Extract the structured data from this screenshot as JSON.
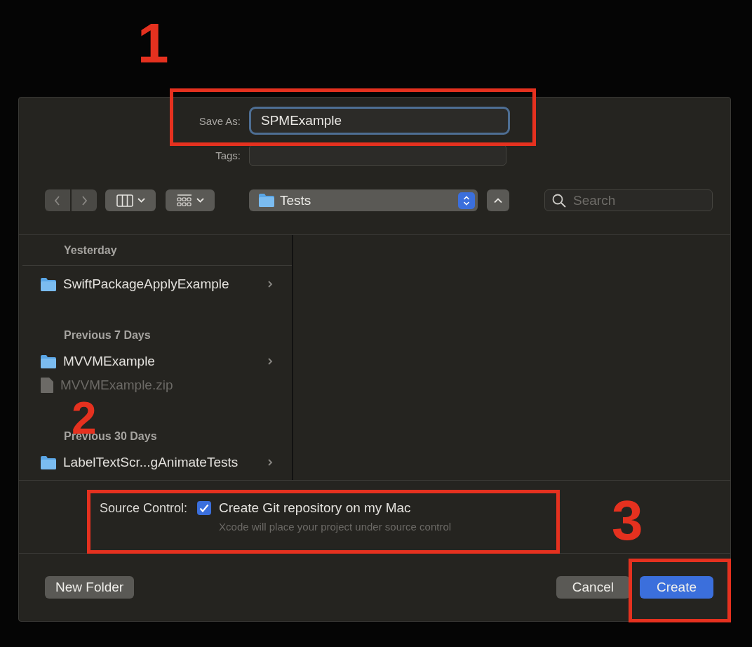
{
  "callouts": [
    {
      "label": "1"
    },
    {
      "label": "2"
    },
    {
      "label": "3"
    }
  ],
  "save_as": {
    "label": "Save As:",
    "value": "SPMExample"
  },
  "tags": {
    "label": "Tags:"
  },
  "toolbar": {
    "location": "Tests",
    "search_placeholder": "Search"
  },
  "sidebar": {
    "groups": [
      {
        "title": "Yesterday",
        "items": [
          {
            "name": "SwiftPackageApplyExample",
            "kind": "folder",
            "disabled": false
          }
        ]
      },
      {
        "title": "Previous 7 Days",
        "items": [
          {
            "name": "MVVMExample",
            "kind": "folder",
            "disabled": false
          },
          {
            "name": "MVVMExample.zip",
            "kind": "file",
            "disabled": true
          }
        ]
      },
      {
        "title": "Previous 30 Days",
        "items": [
          {
            "name": "LabelTextScr...gAnimateTests",
            "kind": "folder",
            "disabled": false
          }
        ]
      }
    ]
  },
  "source_control": {
    "label": "Source Control:",
    "checkbox": {
      "label": "Create Git repository on my Mac",
      "checked": true
    },
    "hint": "Xcode will place your project under source control"
  },
  "buttons": {
    "new_folder": "New Folder",
    "cancel": "Cancel",
    "create": "Create"
  }
}
